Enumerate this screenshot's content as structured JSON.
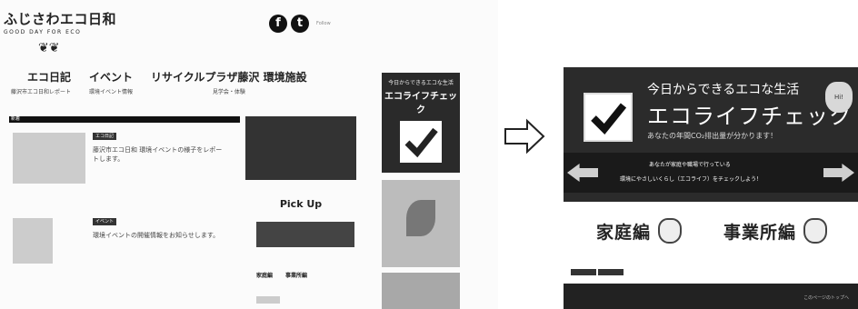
{
  "brand": {
    "title": "ふじさわエコ日和",
    "tagline": "GOOD DAY FOR ECO"
  },
  "social": {
    "fb": "f",
    "tw": "t",
    "small": "Follow"
  },
  "nav": [
    {
      "label": "エコ日記",
      "sub": "藤沢市エコ日和レポート"
    },
    {
      "label": "イベント",
      "sub": "環境イベント情報"
    },
    {
      "label": "リサイクルプラザ藤沢 環境施設",
      "sub": "見学会・体験"
    }
  ],
  "news": {
    "header": "新着"
  },
  "posts": [
    {
      "tag": "エコ日記",
      "text": "藤沢市エコ日和 環境イベントの様子をレポートします。"
    },
    {
      "tag": "イベント",
      "text": "環境イベントの開催情報をお知らせします。"
    }
  ],
  "pickup": {
    "title": "Pick Up",
    "left": "家庭編",
    "right": "事業所編"
  },
  "sidebar": {
    "ecolife_head": "今日からできるエコな生活",
    "ecolife_title": "エコライフチェック"
  },
  "banner": {
    "line1": "今日からできるエコな生活",
    "line2": "エコライフチェック",
    "line3": "あなたの年間CO₂排出量が分かります！",
    "bear": "Hi!",
    "strip1": "あなたが家庭や職場で行っている",
    "strip2": "環境にやさしいくらし（エコライフ）をチェックしよう！",
    "cat_home": "家庭編",
    "cat_office": "事業所編",
    "footer": "このページのトップへ"
  }
}
